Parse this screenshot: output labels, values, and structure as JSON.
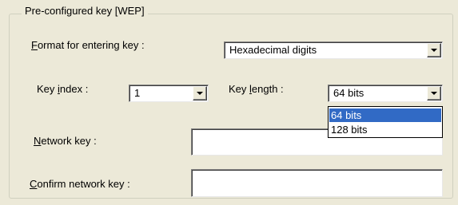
{
  "group": {
    "title": "Pre-configured key [WEP]"
  },
  "format": {
    "label_mnemonic": "F",
    "label_rest": "ormat for entering key :",
    "value": "Hexadecimal digits"
  },
  "key_index": {
    "label_before": "Key ",
    "label_mnemonic": "i",
    "label_after": "ndex :",
    "value": "1"
  },
  "key_length": {
    "label_before": "Key ",
    "label_mnemonic": "l",
    "label_after": "ength :",
    "value": "64 bits",
    "options": [
      "64 bits",
      "128 bits"
    ],
    "highlighted_option": "64 bits"
  },
  "network_key": {
    "label_mnemonic": "N",
    "label_rest": "etwork key :",
    "value": ""
  },
  "confirm_key": {
    "label_mnemonic": "C",
    "label_rest": "onfirm network key :",
    "value": ""
  },
  "colors": {
    "dialog_bg": "#ece9d8",
    "selection_bg": "#316ac5",
    "selection_fg": "#ffffff"
  }
}
